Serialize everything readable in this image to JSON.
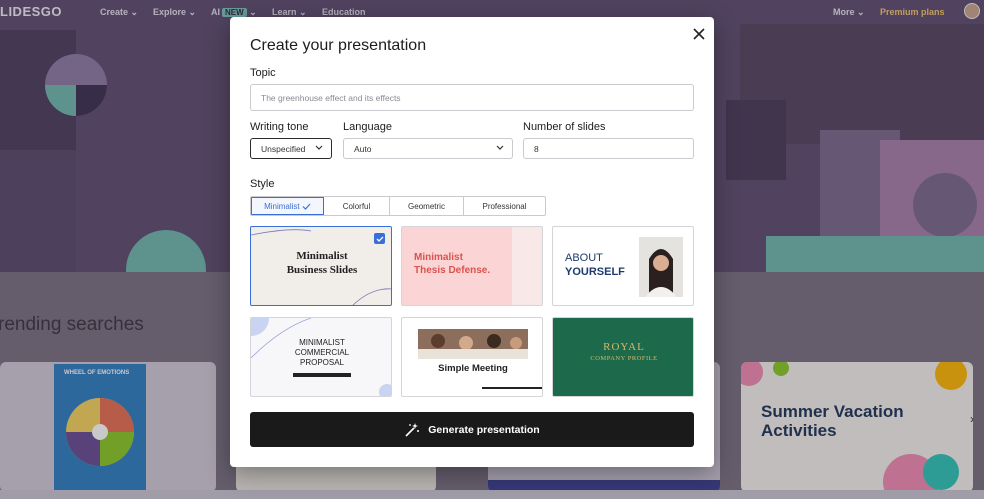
{
  "nav": {
    "logo": "LIDESGO",
    "items": [
      "Create",
      "Explore",
      "AI",
      "Learn",
      "Education"
    ],
    "ai_badge": "NEW",
    "more": "More",
    "premium": "Premium plans"
  },
  "page": {
    "trending_title": "rending searches"
  },
  "modal": {
    "title": "Create your presentation",
    "topic_label": "Topic",
    "topic_placeholder": "The greenhouse effect and its effects",
    "tone_label": "Writing tone",
    "tone_value": "Unspecified",
    "language_label": "Language",
    "language_value": "Auto",
    "slides_label": "Number of slides",
    "slides_value": "8",
    "style_label": "Style",
    "styles": [
      "Minimalist",
      "Colorful",
      "Geometric",
      "Professional"
    ],
    "selected_style": "Minimalist",
    "generate_label": "Generate presentation"
  },
  "templates": [
    {
      "line1": "Minimalist",
      "line2": "Business Slides"
    },
    {
      "line1": "Minimalist",
      "line2": "Thesis Defense."
    },
    {
      "line1": "ABOUT",
      "line2": "YOURSELF"
    },
    {
      "line1": "MINIMALIST",
      "line2": "COMMERCIAL",
      "line3": "PROPOSAL"
    },
    {
      "line1": "Simple Meeting"
    },
    {
      "line1": "ROYAL",
      "line2": "COMPANY PROFILE"
    }
  ],
  "cards": {
    "wheel_title": "WHEEL OF EMOTIONS",
    "summer_line1": "Summer Vacation",
    "summer_line2": "Activities"
  },
  "colors": {
    "accent": "#3a6fd8",
    "hero": "#5f4e70",
    "button": "#1a1a1a",
    "royal": "#1c6a4b"
  }
}
